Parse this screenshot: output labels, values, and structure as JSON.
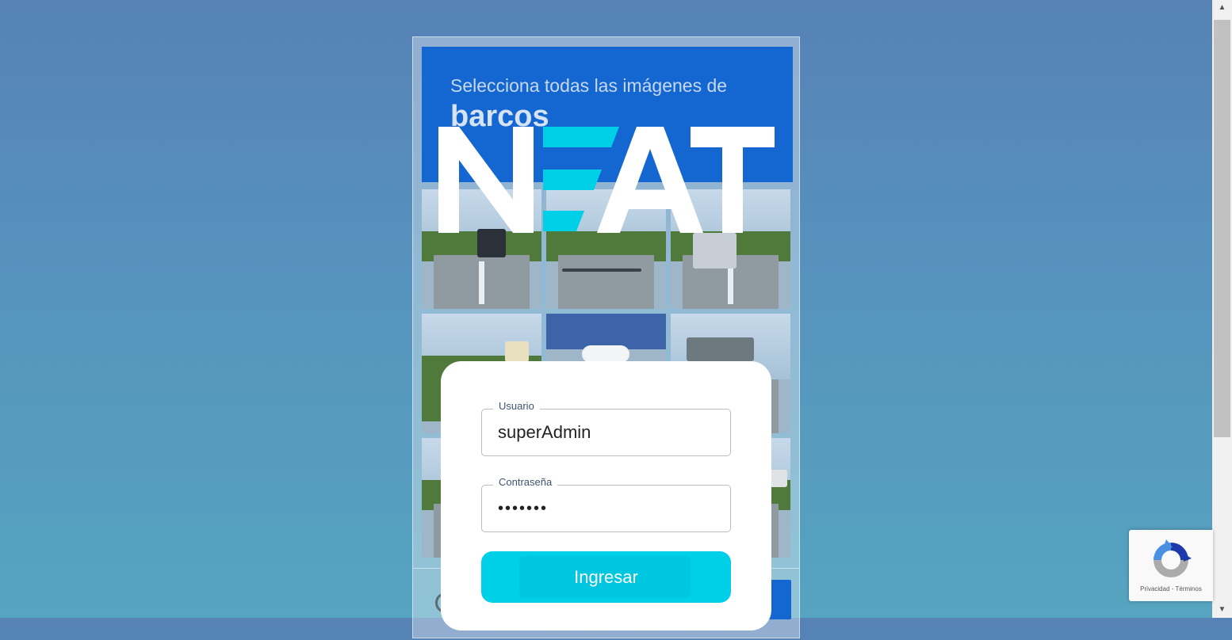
{
  "captcha": {
    "instruction": "Selecciona todas las imágenes de",
    "target": "barcos"
  },
  "logo": {
    "text": "NEAT",
    "letters": [
      "N",
      "E",
      "A",
      "T"
    ]
  },
  "login": {
    "username_label": "Usuario",
    "username_value": "superAdmin",
    "password_label": "Contraseña",
    "password_value": "•••••••",
    "submit_label": "Ingresar"
  },
  "recaptcha": {
    "links": "Privacidad - Términos"
  },
  "colors": {
    "accent": "#00cfe8",
    "captcha_blue": "#1467d0"
  }
}
